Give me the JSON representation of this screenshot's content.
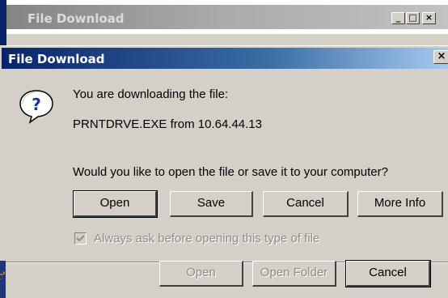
{
  "background_window": {
    "title": "File Download",
    "controls": {
      "minimize": "_",
      "maximize": "□",
      "close": "×"
    },
    "buttons": {
      "open": "Open",
      "open_folder": "Open Folder",
      "cancel": "Cancel"
    },
    "edge_fragment": "r'"
  },
  "dialog": {
    "title": "File Download",
    "close": "×",
    "icon": "question-icon",
    "message_line1": "You are downloading the file:",
    "file_line": "PRNTDRVE.EXE from 10.64.44.13",
    "question": "Would you like to open the file or save it to your computer?",
    "buttons": {
      "open": "Open",
      "save": "Save",
      "cancel": "Cancel",
      "more_info": "More Info"
    },
    "checkbox": {
      "label": "Always ask before opening this type of file",
      "checked": true,
      "enabled": false
    }
  },
  "colors": {
    "active_title_start": "#0a246a",
    "active_title_end": "#a6caf0",
    "inactive_title_start": "#848484",
    "face": "#d4d0c8"
  }
}
